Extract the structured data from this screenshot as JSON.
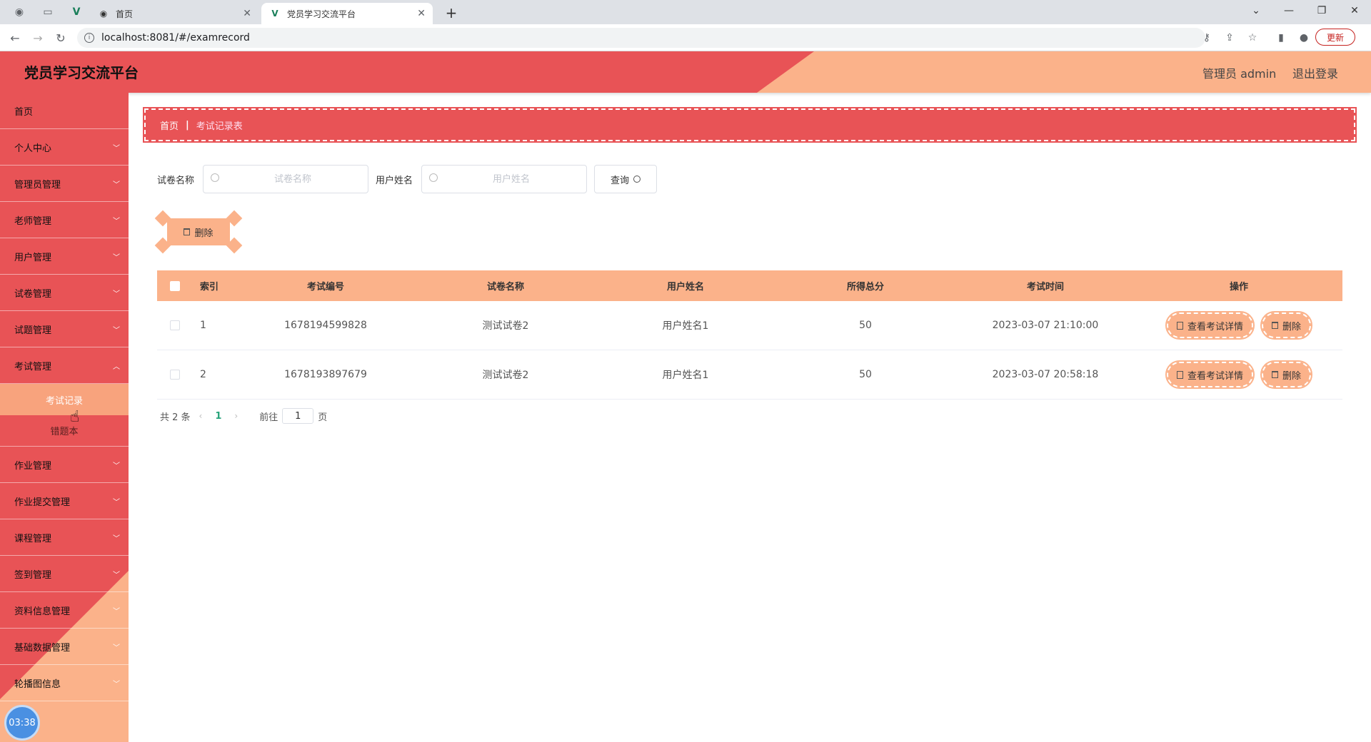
{
  "browser": {
    "tabs": [
      {
        "title": "首页"
      },
      {
        "title": "党员学习交流平台"
      }
    ],
    "new_tab": "+",
    "url": "localhost:8081/#/examrecord",
    "update_label": "更新",
    "window_controls": {
      "minimize": "—",
      "maximize": "❐",
      "close": "✕",
      "tabsearch": "⌄"
    }
  },
  "header": {
    "title": "党员学习交流平台",
    "user": "管理员 admin",
    "logout": "退出登录"
  },
  "sidebar": {
    "items": [
      {
        "label": "首页"
      },
      {
        "label": "个人中心"
      },
      {
        "label": "管理员管理"
      },
      {
        "label": "老师管理"
      },
      {
        "label": "用户管理"
      },
      {
        "label": "试卷管理"
      },
      {
        "label": "试题管理"
      },
      {
        "label": "考试管理"
      },
      {
        "label": "作业管理"
      },
      {
        "label": "作业提交管理"
      },
      {
        "label": "课程管理"
      },
      {
        "label": "签到管理"
      },
      {
        "label": "资料信息管理"
      },
      {
        "label": "基础数据管理"
      },
      {
        "label": "轮播图信息"
      }
    ],
    "submenu": [
      {
        "label": "考试记录"
      },
      {
        "label": "错题本"
      }
    ],
    "clock": "03:38"
  },
  "breadcrumb": {
    "home": "首页",
    "sep": "|",
    "current": "考试记录表"
  },
  "search": {
    "paper_label": "试卷名称",
    "paper_placeholder": "试卷名称",
    "user_label": "用户姓名",
    "user_placeholder": "用户姓名",
    "query_label": "查询"
  },
  "actions": {
    "delete_label": "删除"
  },
  "table": {
    "headers": {
      "index": "索引",
      "exam_no": "考试编号",
      "paper": "试卷名称",
      "user": "用户姓名",
      "score": "所得总分",
      "time": "考试时间",
      "ops": "操作"
    },
    "rows": [
      {
        "index": "1",
        "exam_no": "1678194599828",
        "paper": "测试试卷2",
        "user": "用户姓名1",
        "score": "50",
        "time": "2023-03-07 21:10:00"
      },
      {
        "index": "2",
        "exam_no": "1678193897679",
        "paper": "测试试卷2",
        "user": "用户姓名1",
        "score": "50",
        "time": "2023-03-07 20:58:18"
      }
    ],
    "detail_label": "查看考试详情",
    "row_delete_label": "删除"
  },
  "pager": {
    "total": "共 2 条",
    "current_page": "1",
    "goto_prefix": "前往",
    "goto_value": "1",
    "goto_suffix": "页"
  }
}
